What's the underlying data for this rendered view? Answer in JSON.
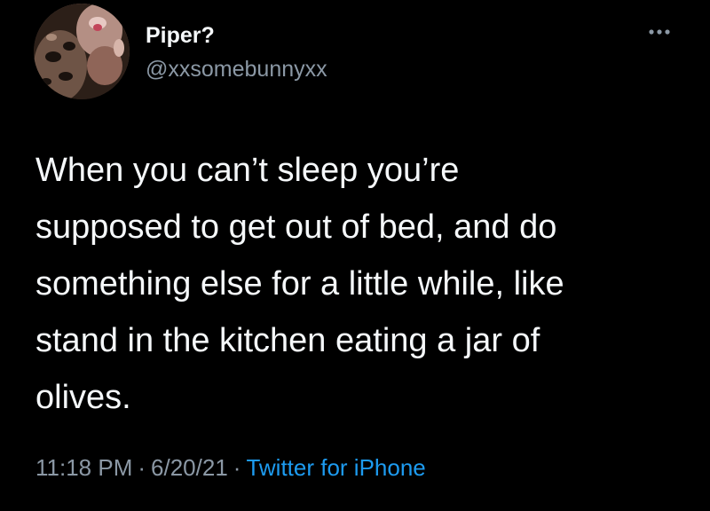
{
  "tweet": {
    "author": {
      "display_name": "Piper?",
      "handle": "@xxsomebunnyxx"
    },
    "text": "When you can’t sleep you’re\nsupposed to get out of bed, and do\nsomething else for a little while, like\nstand in the kitchen eating a jar of\nolives.",
    "time": "11:18 PM",
    "separator": "·",
    "date": "6/20/21",
    "source": "Twitter for iPhone",
    "more_icon": "more-icon"
  },
  "colors": {
    "background": "#000000",
    "text": "#f5f8fa",
    "secondary": "#8b98a5",
    "link": "#1d9bf0"
  }
}
